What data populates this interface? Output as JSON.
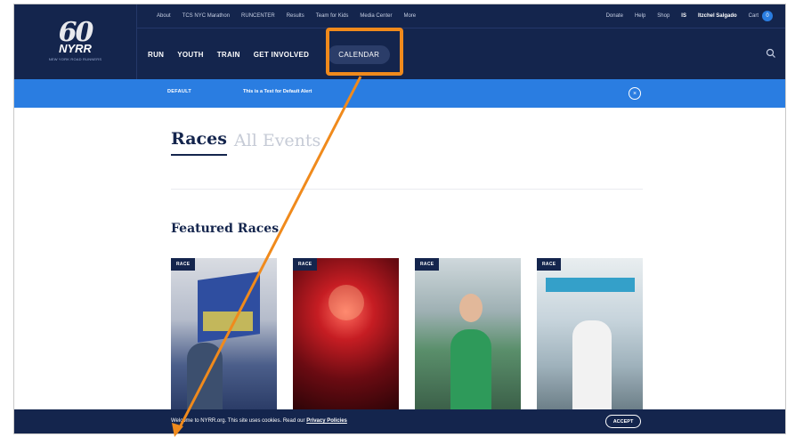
{
  "header": {
    "logo": {
      "main": "60",
      "sub": "NYRR",
      "tagline": "NEW YORK ROAD RUNNERS"
    },
    "util_nav": [
      "About",
      "TCS NYC Marathon",
      "RUNCENTER",
      "Results",
      "Team for Kids",
      "Media Center",
      "More"
    ],
    "util_right": {
      "donate": "Donate",
      "help": "Help",
      "shop": "Shop",
      "initials": "IS",
      "user": "Itzchel Salgado",
      "cart": "Cart",
      "cart_count": "0"
    },
    "main_nav": [
      "RUN",
      "YOUTH",
      "TRAIN",
      "GET INVOLVED",
      "CALENDAR"
    ]
  },
  "alert": {
    "tag": "DEFAULT",
    "message": "This is a Test for Default Alert",
    "close": "×"
  },
  "page": {
    "tabs": [
      "Races",
      "All Events"
    ],
    "featured_title": "Featured Races",
    "cards": [
      {
        "badge": "RACE"
      },
      {
        "badge": "RACE"
      },
      {
        "badge": "RACE"
      },
      {
        "badge": "RACE"
      }
    ]
  },
  "cookie": {
    "text": "Welcome to NYRR.org. This site uses cookies. Read our ",
    "link": "Privacy Policies",
    "accept": "ACCEPT"
  },
  "colors": {
    "navy": "#14254d",
    "blue": "#2a7de1",
    "highlight": "#f08a1c"
  }
}
